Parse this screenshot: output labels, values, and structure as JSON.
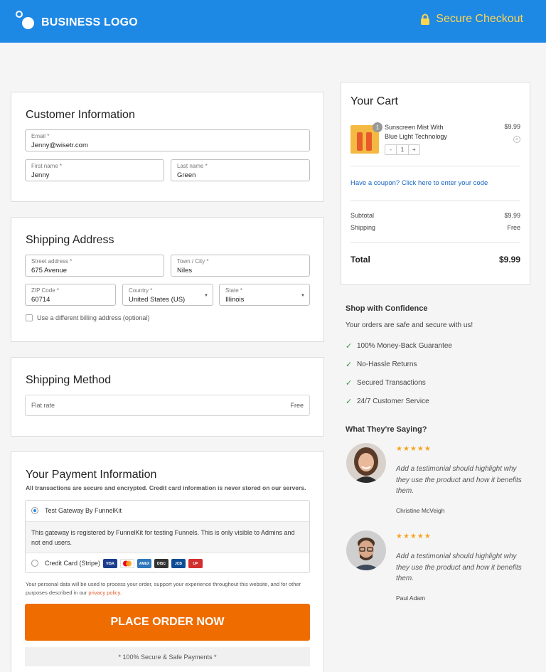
{
  "header": {
    "logo_text": "BUSINESS LOGO",
    "secure_label": "Secure Checkout",
    "brand_color": "#1e88e5"
  },
  "customer": {
    "title": "Customer Information",
    "email": {
      "label": "Email *",
      "value": "Jenny@wisetr.com"
    },
    "first_name": {
      "label": "First name *",
      "value": "Jenny"
    },
    "last_name": {
      "label": "Last name *",
      "value": "Green"
    }
  },
  "shipping_address": {
    "title": "Shipping Address",
    "street": {
      "label": "Street address *",
      "value": "675 Avenue"
    },
    "city": {
      "label": "Town / City *",
      "value": "Niles"
    },
    "zip": {
      "label": "ZIP Code *",
      "value": "60714"
    },
    "country": {
      "label": "Country *",
      "value": "United States (US)"
    },
    "state": {
      "label": "State *",
      "value": "Illinois"
    },
    "billing_checkbox_label": "Use a different billing address (optional)"
  },
  "shipping_method": {
    "title": "Shipping Method",
    "option": "Flat rate",
    "price": "Free"
  },
  "payment": {
    "title": "Your Payment Information",
    "subtitle": "All transactions are secure and encrypted. Credit card information is never stored on our servers.",
    "gateway_label": "Test Gateway By FunnelKit",
    "gateway_desc": "This gateway is registered by FunnelKit for testing Funnels. This is only visible to Admins and not end users.",
    "card_label": "Credit Card (Stripe)",
    "card_brands": [
      "VISA",
      "MC",
      "AMEX",
      "DISC",
      "JCB",
      "UP"
    ],
    "privacy_text": "Your personal data will be used to process your order, support your experience throughout this website, and for other purposes described in our",
    "privacy_link": "privacy policy.",
    "place_order": "PLACE ORDER NOW",
    "secure_note": "* 100% Secure & Safe Payments *",
    "accent_color": "#ef6c00"
  },
  "cart": {
    "title": "Your Cart",
    "item": {
      "name_line1": "Sunscreen Mist With",
      "name_line2": "Blue Light Technology",
      "price": "$9.99",
      "qty": "1",
      "badge": "1",
      "minus": "-",
      "plus": "+"
    },
    "coupon_text": "Have a coupon? Click here to enter your code",
    "subtotal_label": "Subtotal",
    "subtotal_value": "$9.99",
    "shipping_label": "Shipping",
    "shipping_value": "Free",
    "total_label": "Total",
    "total_value": "$9.99"
  },
  "confidence": {
    "title": "Shop with Confidence",
    "subtitle": "Your orders are safe and secure with us!",
    "items": [
      "100% Money-Back Guarantee",
      "No-Hassle Returns",
      "Secured Transactions",
      "24/7 Customer Service"
    ]
  },
  "testimonials": {
    "title": "What They're Saying?",
    "items": [
      {
        "stars": "★★★★★",
        "quote": "Add a testimonial should highlight why they use the product and how it benefits them.",
        "author": "Christine McVeigh"
      },
      {
        "stars": "★★★★★",
        "quote": "Add a testimonial should highlight why they use the product and how it benefits them.",
        "author": "Paul Adam"
      }
    ]
  }
}
